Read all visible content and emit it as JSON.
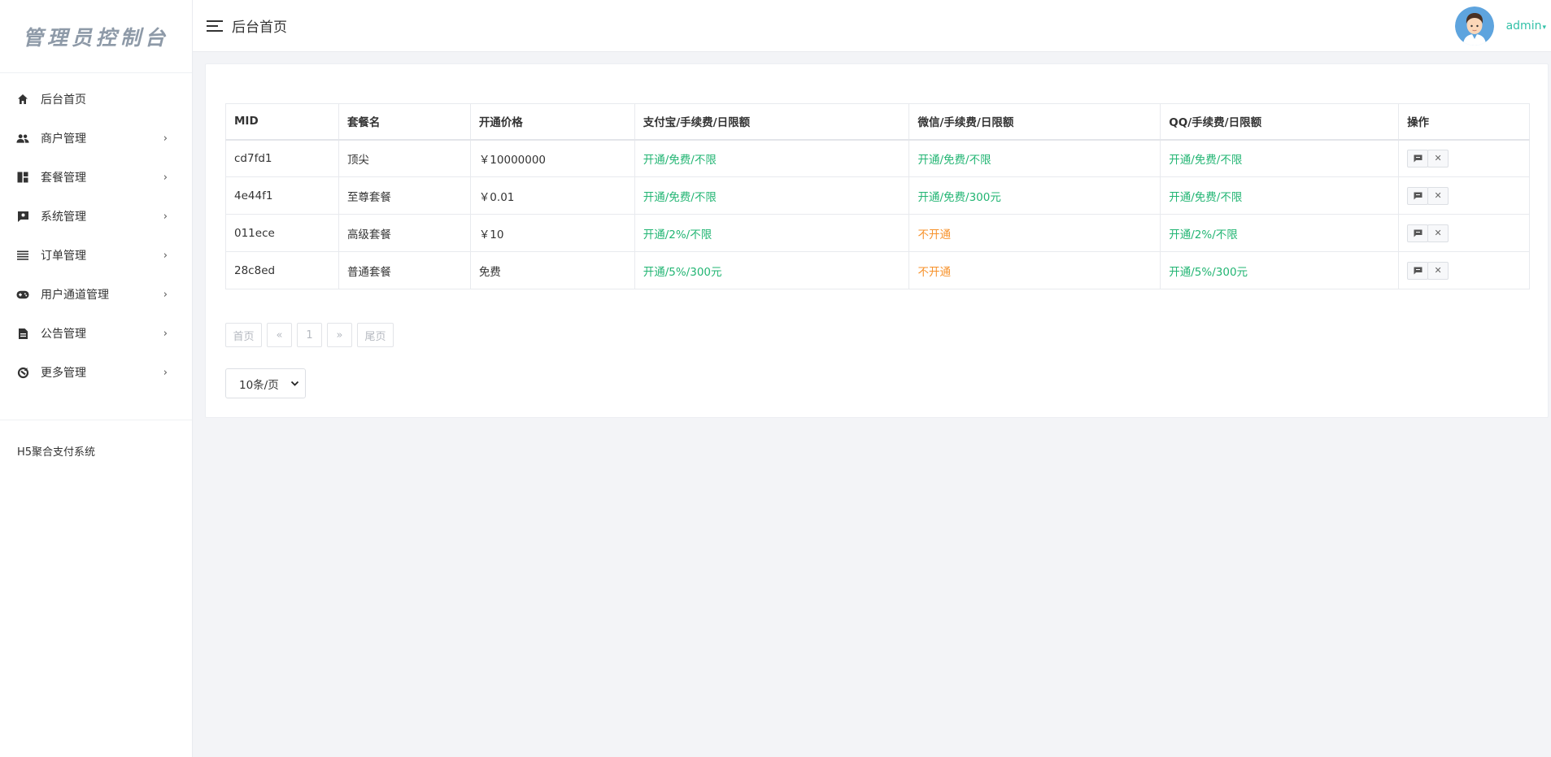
{
  "sidebar": {
    "logo": "管理员控制台",
    "items": [
      {
        "label": "后台首页",
        "icon": "home-icon",
        "chevron": ""
      },
      {
        "label": "商户管理",
        "icon": "people-icon",
        "chevron": "›"
      },
      {
        "label": "套餐管理",
        "icon": "dashboard-icon",
        "chevron": "›"
      },
      {
        "label": "系统管理",
        "icon": "system-icon",
        "chevron": "›"
      },
      {
        "label": "订单管理",
        "icon": "list-icon",
        "chevron": "›"
      },
      {
        "label": "用户通道管理",
        "icon": "gamepad-icon",
        "chevron": "›"
      },
      {
        "label": "公告管理",
        "icon": "document-icon",
        "chevron": "›"
      },
      {
        "label": "更多管理",
        "icon": "refresh-icon",
        "chevron": "›"
      }
    ],
    "footer": "H5聚合支付系统"
  },
  "header": {
    "title": "后台首页",
    "user": "admin",
    "caret": "▾"
  },
  "table": {
    "headers": [
      "MID",
      "套餐名",
      "开通价格",
      "支付宝/手续费/日限额",
      "微信/手续费/日限额",
      "QQ/手续费/日限额",
      "操作"
    ],
    "rows": [
      {
        "mid": "cd7fd1",
        "name": "顶尖",
        "price": "￥10000000",
        "alipay": "开通/免费/不限",
        "wechat": "开通/免费/不限",
        "qq": "开通/免费/不限"
      },
      {
        "mid": "4e44f1",
        "name": "至尊套餐",
        "price": "￥0.01",
        "alipay": "开通/免费/不限",
        "wechat": "开通/免费/300元",
        "qq": "开通/免费/不限"
      },
      {
        "mid": "011ece",
        "name": "高级套餐",
        "price": "￥10",
        "alipay": "开通/2%/不限",
        "wechat": "不开通",
        "qq": "开通/2%/不限"
      },
      {
        "mid": "28c8ed",
        "name": "普通套餐",
        "price": "免费",
        "alipay": "开通/5%/300元",
        "wechat": "不开通",
        "qq": "开通/5%/300元"
      }
    ],
    "actions": {
      "edit_icon": "edit-icon",
      "delete_glyph": "✕"
    }
  },
  "pagination": {
    "first": "首页",
    "prev": "«",
    "current": "1",
    "next": "»",
    "last": "尾页"
  },
  "page_size": {
    "selected": "10条/页"
  },
  "colors": {
    "accent": "#33c1a8",
    "enabled": "#22b573",
    "disabled": "#f7922b"
  }
}
